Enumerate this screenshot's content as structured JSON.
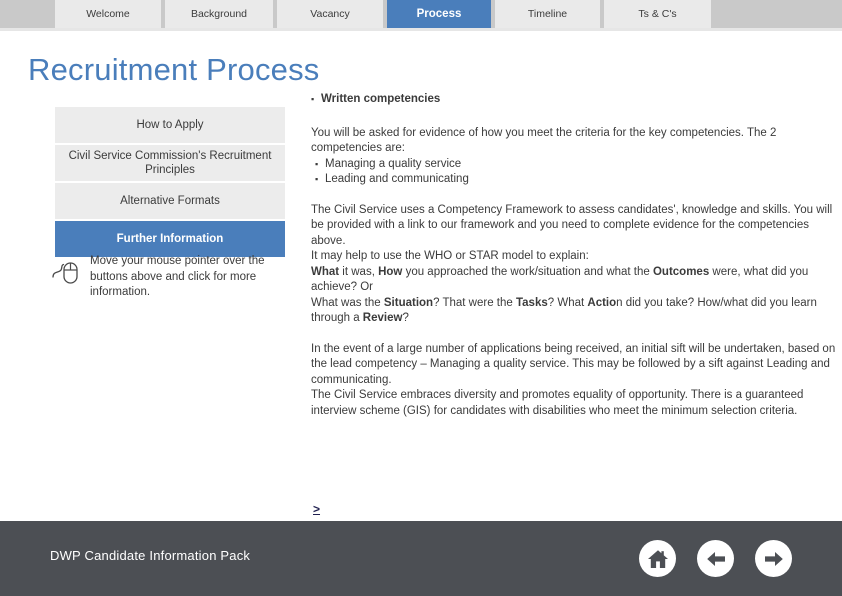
{
  "tabs": [
    {
      "label": "Welcome",
      "active": false
    },
    {
      "label": "Background",
      "active": false
    },
    {
      "label": "Vacancy",
      "active": false
    },
    {
      "label": "Process",
      "active": true
    },
    {
      "label": "Timeline",
      "active": false
    },
    {
      "label": "Ts & C's",
      "active": false
    }
  ],
  "page_title": "Recruitment Process",
  "sidebar": {
    "items": [
      {
        "label": "How to Apply",
        "active": false
      },
      {
        "label": "Civil Service Commission's Recruitment Principles",
        "active": false
      },
      {
        "label": "Alternative Formats",
        "active": false
      },
      {
        "label": "Further Information",
        "active": true
      }
    ],
    "hint_icon": "mouse-icon",
    "hint_text": "Move your mouse pointer over the buttons above and click for more information."
  },
  "content": {
    "heading_bullet": "Written competencies",
    "intro": "You will be asked for evidence of how you meet the criteria for the key competencies. The 2 competencies are:",
    "competencies": [
      "Managing a quality service",
      "Leading and communicating"
    ],
    "framework_para": "The Civil Service uses a Competency Framework to assess candidates', knowledge and skills. You will be provided with a link to our framework and you need to complete evidence for the competencies above.",
    "model_intro": "It may help to use the WHO or STAR model to explain:",
    "who_line": {
      "b1": "What",
      "t1": " it was, ",
      "b2": "How",
      "t2": " you approached the work/situation and what the ",
      "b3": "Outcomes",
      "t3": " were, what did you achieve? Or"
    },
    "star_line": {
      "t0": "What was the ",
      "b1": "Situation",
      "t1": "? That were the ",
      "b2": "Tasks",
      "t2": "? What ",
      "b3": "Actio",
      "t3": "n did you take? How/what did you learn through a ",
      "b4": "Review",
      "t4": "?"
    },
    "sift_para": "In the event of a large number of applications being received, an initial sift will be undertaken, based on the lead competency – Managing a quality service. This may be followed by a sift against Leading and communicating.",
    "diversity_para": "The Civil Service embraces diversity and promotes equality of opportunity. There is a guaranteed interview scheme (GIS) for candidates with disabilities who meet the minimum selection criteria.",
    "more_link": ">"
  },
  "footer": {
    "title": "DWP Candidate Information Pack",
    "nav": [
      {
        "name": "home-icon",
        "label": "Home"
      },
      {
        "name": "arrow-left-icon",
        "label": "Back"
      },
      {
        "name": "arrow-right-icon",
        "label": "Next"
      }
    ]
  },
  "colors": {
    "accent": "#4a7ebb",
    "tabbar_bg": "#c9c9c9",
    "tab_bg": "#eaeaea",
    "side_btn_bg": "#ececec",
    "footer_bg": "#4c4f54",
    "text": "#3b3b3b",
    "link": "#1f1f4f"
  }
}
